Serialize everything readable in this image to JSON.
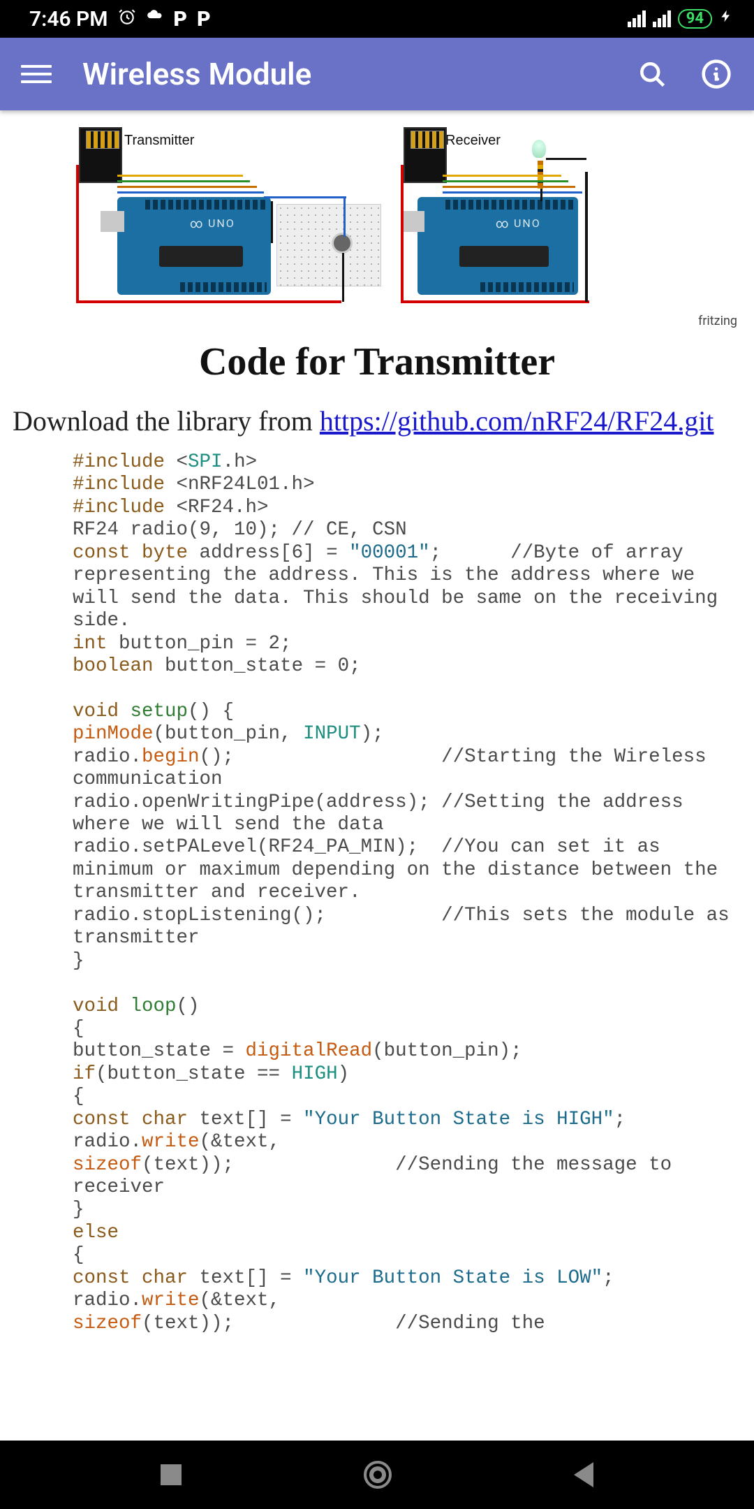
{
  "status": {
    "time": "7:46 PM",
    "battery": "94"
  },
  "header": {
    "title": "Wireless Module"
  },
  "diagram": {
    "transmitter_label": "Transmitter",
    "receiver_label": "Receiver",
    "board_label": "UNO",
    "credit": "fritzing"
  },
  "section": {
    "title": "Code for Transmitter",
    "download_prefix": "Download the library from ",
    "download_link": "https://github.com/nRF24/RF24.git"
  },
  "code": {
    "inc1_pre": "#include",
    "inc1_open": " <",
    "inc1_lib": "SPI",
    "inc1_close": ".h>",
    "inc2": " <nRF24L01.h>",
    "inc3": " <RF24.h>",
    "l4": "RF24 radio(9, 10); // CE, CSN",
    "l5a": "const",
    "l5b": "byte",
    "l5c": " address[6] = ",
    "l5d": "\"00001\"",
    "l5e": ";      //Byte of array representing the address. This is the address where we will send the data. This should be same on the receiving side.",
    "l6a": "int",
    "l6b": " button_pin = 2;",
    "l7a": "boolean",
    "l7b": " button_state = 0;",
    "l8a": "void",
    "l8b": "setup",
    "l8c": "() {",
    "l9a": "pinMode",
    "l9b": "(button_pin, ",
    "l9c": "INPUT",
    "l9d": ");",
    "l10a": "radio.",
    "l10b": "begin",
    "l10c": "();                  //Starting the Wireless communication",
    "l11": "radio.openWritingPipe(address); //Setting the address where we will send the data",
    "l12": "radio.setPALevel(RF24_PA_MIN);  //You can set it as minimum or maximum depending on the distance between the transmitter and receiver.",
    "l13": "radio.stopListening();          //This sets the module as transmitter",
    "l14": "}",
    "l15a": "void",
    "l15b": "loop",
    "l15c": "()",
    "l16": "{",
    "l17a": "button_state = ",
    "l17b": "digitalRead",
    "l17c": "(button_pin);",
    "l18a": "if",
    "l18b": "(button_state == ",
    "l18c": "HIGH",
    "l18d": ")",
    "l19": "{",
    "l20a": "const",
    "l20b": "char",
    "l20c": " text[] = ",
    "l20d": "\"Your Button State is HIGH\"",
    "l20e": ";",
    "l21a": "radio.",
    "l21b": "write",
    "l21c": "(&text, ",
    "l22a": "sizeof",
    "l22b": "(text));              //Sending the message to receiver",
    "l23": "}",
    "l24": "else",
    "l25": "{",
    "l26a": "const",
    "l26b": "char",
    "l26c": " text[] = ",
    "l26d": "\"Your Button State is LOW\"",
    "l26e": ";",
    "l27a": "radio.",
    "l27b": "write",
    "l27c": "(&text, ",
    "l28a": "sizeof",
    "l28b": "(text));              //Sending the"
  }
}
